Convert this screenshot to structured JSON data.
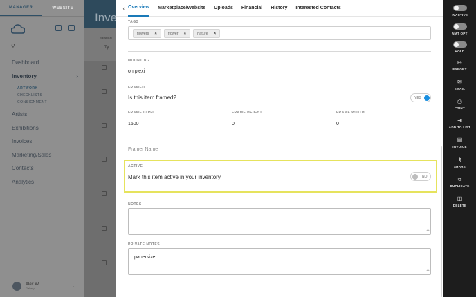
{
  "sidebar": {
    "tabs": [
      {
        "label": "MANAGER"
      },
      {
        "label": "WEBSITE"
      }
    ],
    "nav": {
      "dashboard": "Dashboard",
      "inventory": "Inventory",
      "inventory_sub": [
        "ARTWORK",
        "CHECKLISTS",
        "CONSIGNMENT"
      ],
      "items": [
        "Artists",
        "Exhibitions",
        "Invoices",
        "Marketing/Sales",
        "Contacts",
        "Analytics"
      ]
    },
    "user": {
      "name": "Alex W",
      "sub": "Gallery"
    }
  },
  "background": {
    "title": "Inven",
    "search_label": "SEARCH",
    "search_value": "Ty"
  },
  "modal": {
    "tabs": [
      "Overview",
      "Marketplace/Website",
      "Uploads",
      "Financial",
      "History",
      "Interested Contacts"
    ],
    "tags": {
      "label": "TAGS",
      "items": [
        "flowers",
        "flower",
        "nature"
      ]
    },
    "mounting": {
      "label": "MOUNTING",
      "value": "on plexi"
    },
    "framed": {
      "label": "FRAMED",
      "question": "Is this item framed?",
      "toggle": "YES"
    },
    "frame_cost": {
      "label": "FRAME COST",
      "value": "1500"
    },
    "frame_height": {
      "label": "FRAME HEIGHT",
      "value": "0"
    },
    "frame_width": {
      "label": "FRAME WIDTH",
      "value": "0"
    },
    "framer_name": {
      "placeholder": "Framer Name"
    },
    "active": {
      "label": "ACTIVE",
      "question": "Mark this item active in your inventory",
      "toggle": "NO"
    },
    "notes": {
      "label": "NOTES",
      "value": ""
    },
    "private_notes": {
      "label": "PRIVATE NOTES",
      "value": "papersize:"
    }
  },
  "rail": {
    "inactive": "INACTIVE",
    "nmt_opt": "NMT OPT",
    "hold": "HOLD",
    "export": "EXPORT",
    "email": "EMAIL",
    "print": "PRINT",
    "add_to_list": "ADD TO LIST",
    "invoice": "INVOICE",
    "share": "SHARE",
    "duplicate": "DUPLICATE",
    "delete": "DELETE"
  },
  "colors": {
    "accent": "#1a7ab8",
    "highlight": "#e6e35d",
    "rail_bg": "#1d1d1d"
  }
}
